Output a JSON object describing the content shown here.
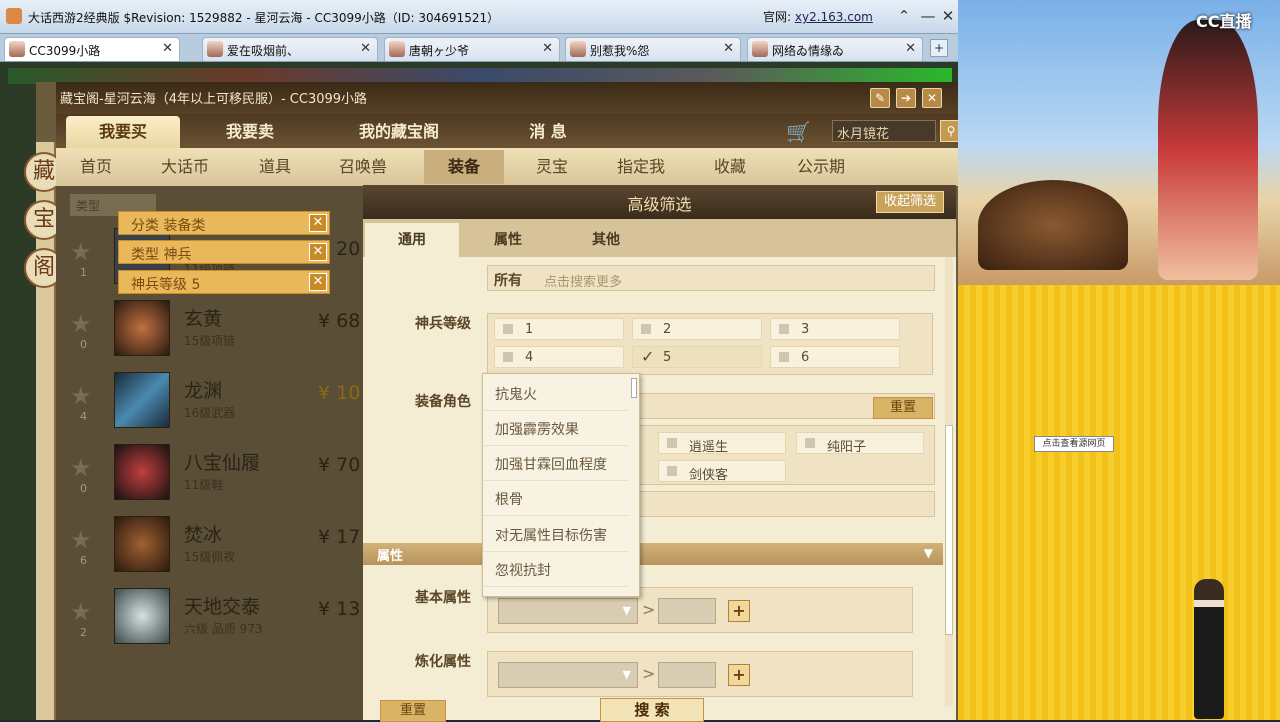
{
  "window": {
    "title": "大话西游2经典版 $Revision: 1529882 - 星河云海 - CC3099小路（ID: 304691521）",
    "site_label": "官网:",
    "site_url": "xy2.163.com"
  },
  "tabs": [
    {
      "label": "CC3099小路"
    },
    {
      "label": "爱在吸烟前、"
    },
    {
      "label": "唐朝ヶ少爷"
    },
    {
      "label": "别惹我%怨"
    },
    {
      "label": "网络ゐ情缘ゐ"
    }
  ],
  "panel": {
    "title": "藏宝阁-星河云海（4年以上可移民服）- CC3099小路",
    "side_chars": [
      "藏",
      "宝",
      "阁"
    ],
    "top_tabs": [
      "我要买",
      "我要卖",
      "我的藏宝阁",
      "消 息"
    ],
    "search_value": "水月镜花",
    "categories": [
      "首页",
      "大话币",
      "道具",
      "召唤兽",
      "装备",
      "灵宝",
      "指定我",
      "收藏",
      "公示期"
    ]
  },
  "list": {
    "type_select": "类型",
    "chips": [
      "分类  装备类",
      "类型  神兵",
      "神兵等级  5"
    ],
    "items": [
      {
        "count": "1",
        "name": "",
        "sub": "11级项链",
        "price": "¥ 20"
      },
      {
        "count": "0",
        "name": "玄黄",
        "sub": "15级项链",
        "price": "¥ 68"
      },
      {
        "count": "4",
        "name": "龙渊",
        "sub": "16级武器",
        "price": "¥ 10"
      },
      {
        "count": "0",
        "name": "八宝仙履",
        "sub": "11级鞋",
        "price": "¥ 70"
      },
      {
        "count": "6",
        "name": "焚冰",
        "sub": "15级佩衩",
        "price": "¥ 17"
      },
      {
        "count": "2",
        "name": "天地交泰",
        "sub": "六级 品质 973",
        "price": "¥ 13"
      }
    ]
  },
  "filter": {
    "title": "高级筛选",
    "collapse_label": "收起筛选",
    "tabs": [
      "通用",
      "属性",
      "其他"
    ],
    "all_label": "所有",
    "all_placeholder": "点击搜索更多",
    "level_label": "神兵等级",
    "levels": [
      "1",
      "2",
      "3",
      "4",
      "5",
      "6"
    ],
    "role_label": "装备角色",
    "reset_label": "重置",
    "roles": [
      "逍遥生",
      "纯阳子",
      "剑侠客"
    ],
    "section_attr": "属性",
    "base_attr_label": "基本属性",
    "refine_attr_label": "炼化属性",
    "dropdown_items": [
      "抗鬼火",
      "加强霹雳效果",
      "加强甘霖回血程度",
      "根骨",
      "对无属性目标伤害",
      "忽视抗封"
    ],
    "bottom_reset": "重置",
    "search_label": "搜 索"
  },
  "right": {
    "logo": "CC直播",
    "click_view": "点击查看源网页"
  }
}
